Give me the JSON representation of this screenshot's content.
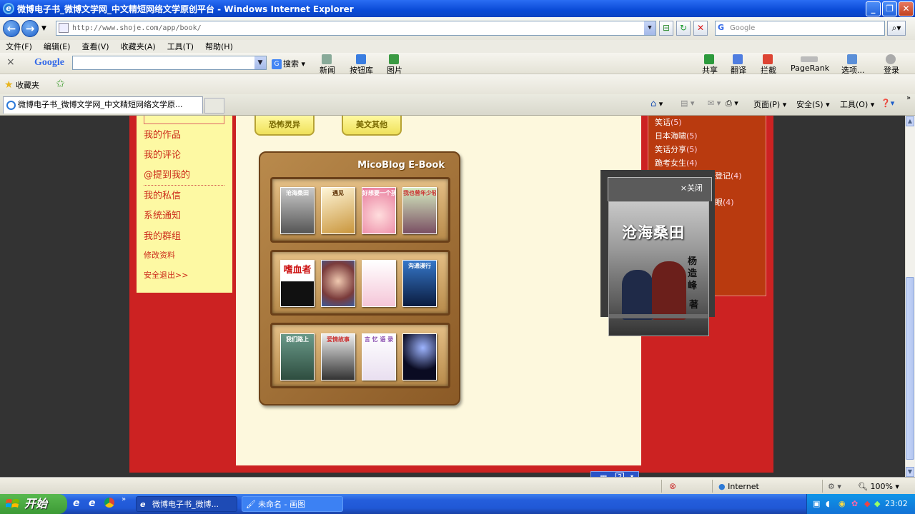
{
  "window": {
    "title": "微博电子书_微博文学网_中文精短网络文学原创平台 - Windows Internet Explorer"
  },
  "addressbar": {
    "url": "http://www.shoje.com/app/book/",
    "search_placeholder": "Google"
  },
  "menu": [
    "文件(F)",
    "编辑(E)",
    "查看(V)",
    "收藏夹(A)",
    "工具(T)",
    "帮助(H)"
  ],
  "google_toolbar": {
    "logo": "Google",
    "search_label": "搜索",
    "news": "新闻",
    "buttons_lib": "按钮库",
    "images": "图片",
    "share": "共享",
    "translate": "翻译",
    "block": "拦截",
    "pagerank": "PageRank",
    "options": "选项...",
    "login": "登录"
  },
  "favorites": {
    "label": "收藏夹"
  },
  "tab": {
    "title": "微博电子书_微博文学网_中文精短网络文学原..."
  },
  "command": {
    "page": "页面(P)",
    "safety": "安全(S)",
    "tools": "工具(O)"
  },
  "sidebar": {
    "items": [
      "我的作品",
      "我的评论",
      "@提到我的",
      "我的私信",
      "系统通知",
      "我的群组",
      "修改资料",
      "安全退出>>"
    ]
  },
  "categories": [
    "恐怖灵异",
    "美文其他"
  ],
  "shelf": {
    "title": "MicoBlog E-Book",
    "rows": [
      [
        "沧海桑田",
        "遇见",
        "好想要一个孩子",
        "我也曾年少轻狂"
      ],
      [
        "嗜血者",
        "",
        "",
        "沟通漫行"
      ],
      [
        "我们路上",
        "爱情故事",
        "言 忆 语 录",
        ""
      ]
    ]
  },
  "right_list": [
    {
      "name": "笑话",
      "count": "(5)"
    },
    {
      "name": "日本海啸",
      "count": "(5)"
    },
    {
      "name": "笑话分享",
      "count": "(5)"
    },
    {
      "name": "跪考女生",
      "count": "(4)"
    },
    {
      "name": "登记",
      "count": "(4)"
    },
    {
      "name": "眼",
      "count": "(4)"
    }
  ],
  "popup": {
    "close": "×关闭",
    "cover_title": "沧海桑田",
    "author": "杨造峰",
    "suffix": "著"
  },
  "statusbar": {
    "zone": "Internet",
    "zoom": "100%"
  },
  "taskbar": {
    "start": "开始",
    "tasks": [
      "微博电子书_微博...",
      "未命名 - 画图"
    ],
    "clock": "23:02"
  }
}
